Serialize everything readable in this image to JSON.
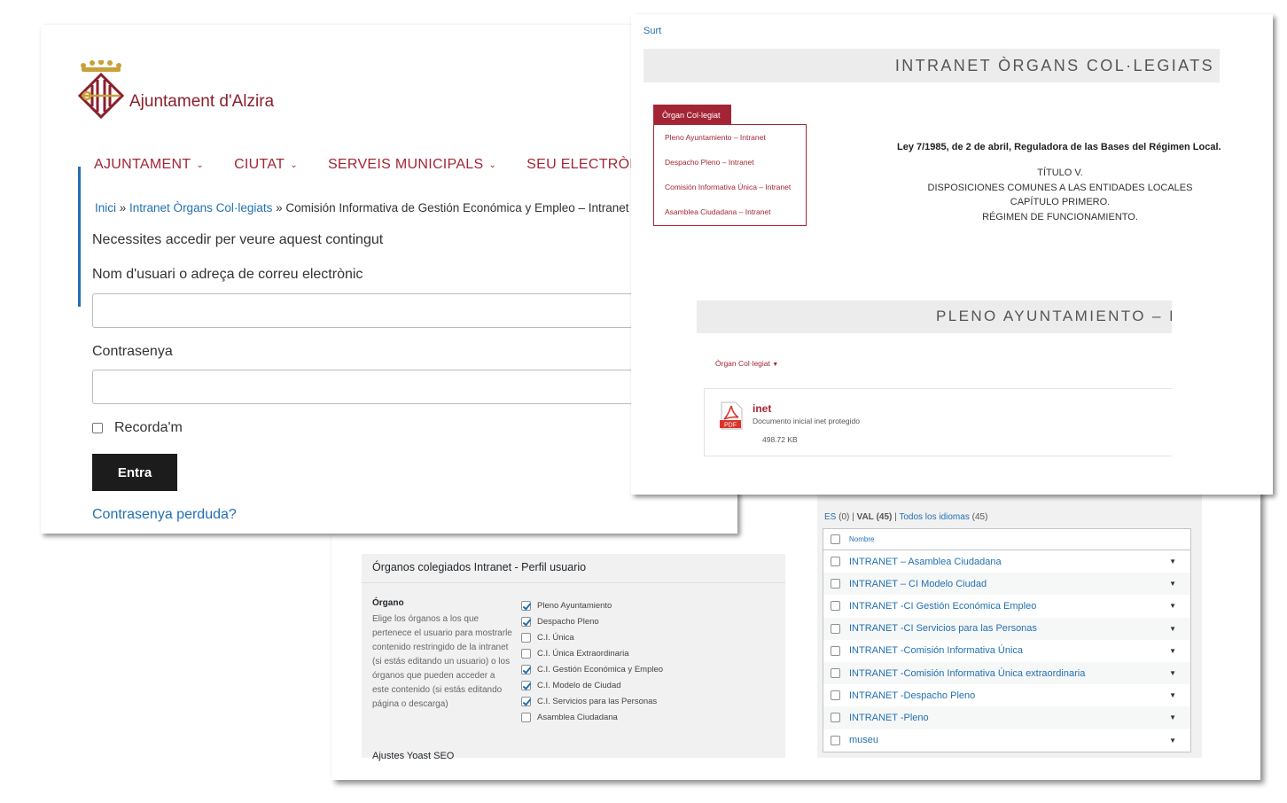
{
  "login_page": {
    "logo_text": "Ajuntament d'Alzira",
    "nav": [
      "AJUNTAMENT",
      "CIUTAT",
      "SERVEIS MUNICIPALS",
      "SEU ELECTRÒNICA"
    ],
    "breadcrumb": {
      "home": "Inici",
      "sep1": " » ",
      "section": "Intranet Òrgans Col·legiats",
      "sep2": " » ",
      "current": "Comisión Informativa de Gestión Económica y Empleo – Intranet"
    },
    "need_login": "Necessites accedir per veure aquest contingut",
    "username_label": "Nom d'usuari o adreça de correu electrònic",
    "password_label": "Contrasenya",
    "remember_label": "Recorda'm",
    "submit_label": "Entra",
    "lost_password": "Contrasenya perduda?"
  },
  "intranet_page": {
    "exit_link": "Surt",
    "header": "INTRANET ÒRGANS COL·LEGIATS",
    "menu_tab": "Òrgan Col·legiat",
    "menu_items": [
      "Pleno Ayuntamiento – Intranet",
      "Despacho Pleno – Intranet",
      "Comisión Informativa Única – Intranet",
      "Asamblea Ciudadana – Intranet"
    ],
    "law_title": "Ley 7/1985, de 2 de abril, Reguladora de las Bases del Régimen Local.",
    "law_lines": [
      "TÍTULO V.",
      "DISPOSICIONES COMUNES A LAS ENTIDADES LOCALES",
      "CAPÍTULO PRIMERO.",
      "RÉGIMEN DE FUNCIONAMIENTO."
    ],
    "section_header": "PLENO AYUNTAMIENTO – I",
    "organ_dropdown": "Òrgan Col·legiat",
    "document": {
      "title": "inet",
      "description": "Documento inicial inet protegido",
      "size": "498.72 KB",
      "badge": "PDF"
    }
  },
  "profile_box": {
    "title": "Órganos colegiados Intranet - Perfil usuario",
    "field_label": "Órgano",
    "description": "Elige los órganos a los que pertenece el usuario para mostrarle contenido restringido de la intranet (si estás editando un usuario) o los órganos que pueden acceder a este contenido (si estás editando página o descarga)",
    "options": [
      {
        "label": "Pleno Ayuntamiento",
        "checked": true
      },
      {
        "label": "Despacho Pleno",
        "checked": true
      },
      {
        "label": "C.I. Única",
        "checked": false
      },
      {
        "label": "C.I. Única Extraordinaria",
        "checked": false
      },
      {
        "label": "C.I. Gestión Económica y Empleo",
        "checked": true
      },
      {
        "label": "C.I. Modelo de Ciudad",
        "checked": true
      },
      {
        "label": "C.I. Servicios para las Personas",
        "checked": true
      },
      {
        "label": "Asamblea Ciudadana",
        "checked": false
      }
    ],
    "next_section": "Ajustes Yoast SEO"
  },
  "taxonomy_box": {
    "filters": {
      "es": "ES",
      "es_count": "(0)",
      "sep1": " | ",
      "val": "VAL",
      "val_count": "(45)",
      "sep2": " | ",
      "all": "Todos los idiomas",
      "all_count": "(45)"
    },
    "column_header": "Nombre",
    "rows": [
      "INTRANET – Asamblea Ciudadana",
      "INTRANET – CI Modelo Ciudad",
      "INTRANET -CI Gestión Económica Empleo",
      "INTRANET -CI Servicios para las Personas",
      "INTRANET -Comisión Informativa Única",
      "INTRANET -Comisión Informativa Única extraordinaria",
      "INTRANET -Despacho Pleno",
      "INTRANET -Pleno",
      "museu"
    ]
  },
  "colors": {
    "brand_red": "#a32535",
    "link_blue": "#2271b1",
    "dark_button": "#1c1c1c"
  }
}
